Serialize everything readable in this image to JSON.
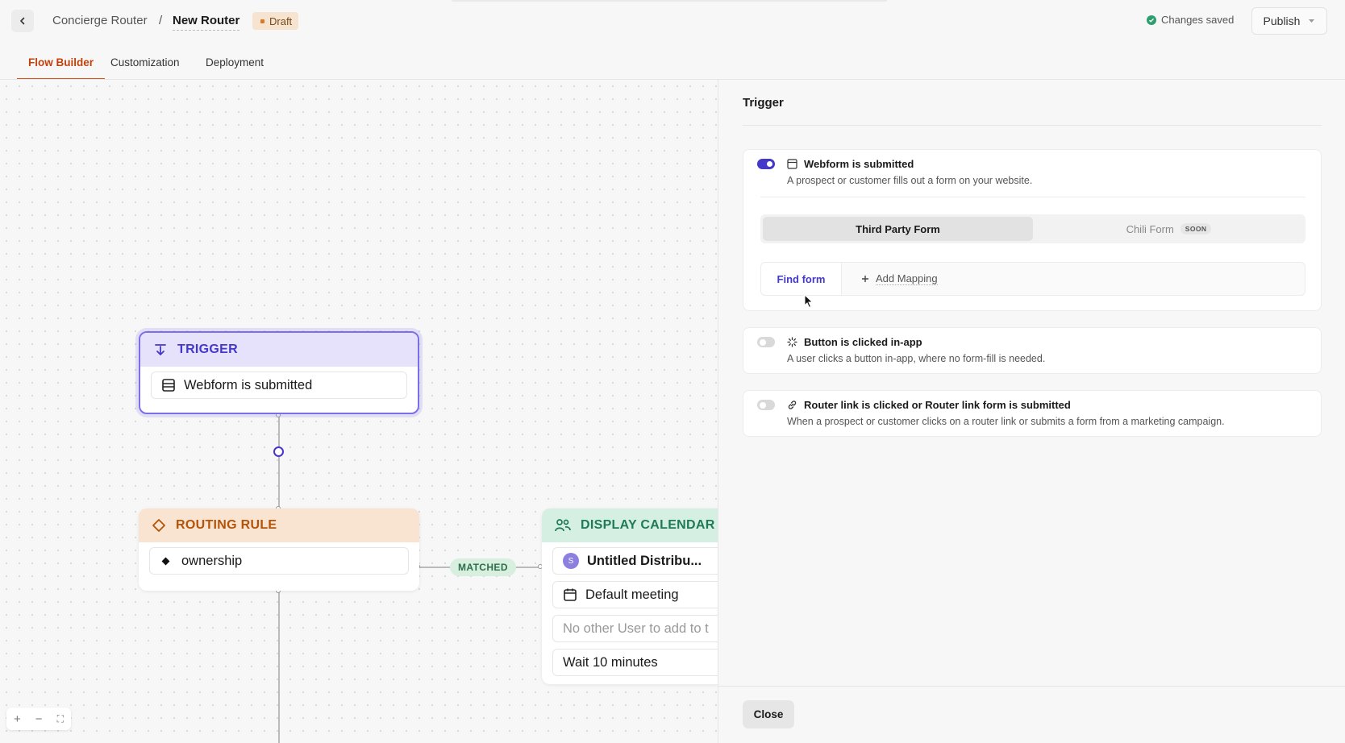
{
  "header": {
    "breadcrumb_parent": "Concierge Router",
    "breadcrumb_separator": "/",
    "breadcrumb_current": "New Router",
    "status_badge": "Draft",
    "save_status": "Changes saved",
    "publish_label": "Publish"
  },
  "tabs": [
    {
      "label": "Flow Builder",
      "active": true
    },
    {
      "label": "Customization",
      "active": false
    },
    {
      "label": "Deployment",
      "active": false
    }
  ],
  "canvas": {
    "trigger_node": {
      "title": "TRIGGER",
      "row": "Webform is submitted",
      "color": "#4338ca"
    },
    "routing_node": {
      "title": "ROUTING RULE",
      "row": "ownership",
      "color": "#b45309"
    },
    "matched_label": "MATCHED",
    "calendar_node": {
      "title": "DISPLAY CALENDAR",
      "avatar_letter": "S",
      "rows": [
        "Untitled Distribu...",
        "Default meeting",
        "No other User to add to t",
        "Wait 10 minutes"
      ],
      "color": "#1f7a55"
    },
    "zoom_controls": [
      "+",
      "−",
      "⛶"
    ]
  },
  "panel": {
    "title": "Trigger",
    "options": [
      {
        "enabled": true,
        "title": "Webform is submitted",
        "description": "A prospect or customer fills out a form on your website.",
        "icon": "form-icon"
      },
      {
        "enabled": false,
        "title": "Button is clicked in-app",
        "description": "A user clicks a button in-app, where no form-fill is needed.",
        "icon": "click-icon"
      },
      {
        "enabled": false,
        "title": "Router link is clicked or Router link form is submitted",
        "description": "When a prospect or customer clicks on a router link or submits a form from a marketing campaign.",
        "icon": "link-icon"
      }
    ],
    "form_types": {
      "active": "Third Party Form",
      "inactive": "Chili Form",
      "inactive_badge": "SOON"
    },
    "find_form": "Find form",
    "add_mapping": "Add Mapping",
    "close_label": "Close"
  }
}
